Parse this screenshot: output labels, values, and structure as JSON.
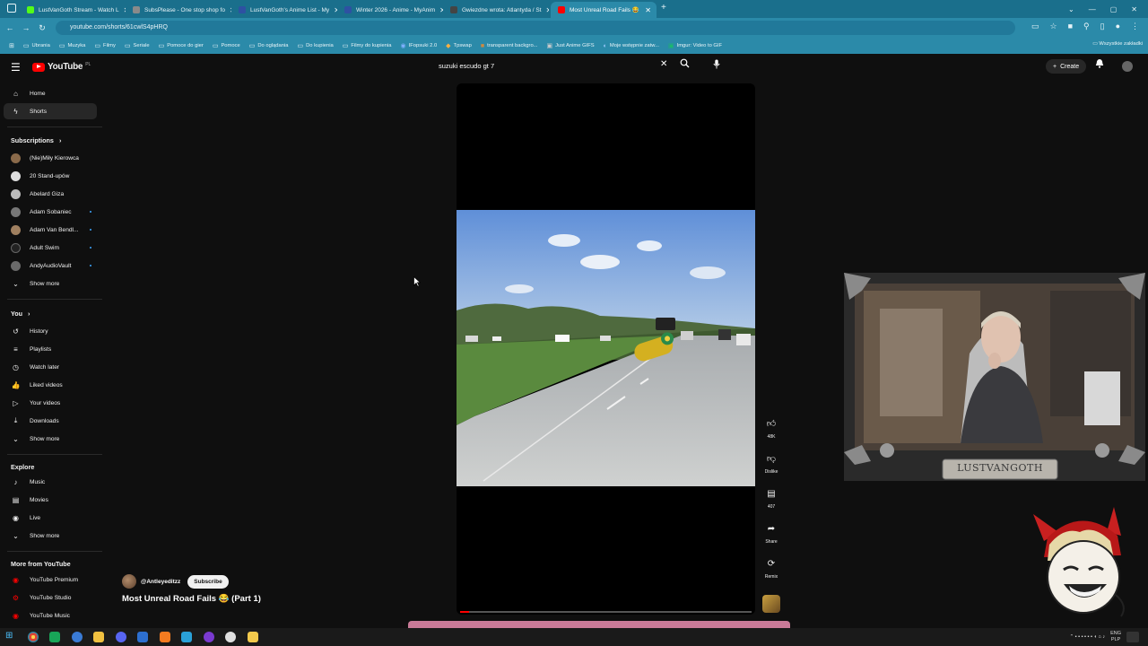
{
  "browser": {
    "tabs": [
      {
        "title": "LustVanGoth Stream - Watch L",
        "favicon_color": "#53fc18",
        "active": false
      },
      {
        "title": "SubsPlease - One stop shop fo",
        "favicon_color": "#8a8a8a",
        "active": false
      },
      {
        "title": "LustVanGoth's Anime List - My",
        "favicon_color": "#2e51a2",
        "active": false
      },
      {
        "title": "Winter 2026 - Anime - MyAnim",
        "favicon_color": "#2e51a2",
        "active": false
      },
      {
        "title": "Gwiezdne wrota: Atlantyda / St",
        "favicon_color": "#444444",
        "active": false
      },
      {
        "title": "Most Unreal Road Fails 😂",
        "favicon_color": "#ff0000",
        "active": true
      }
    ],
    "url": "youtube.com/shorts/61cwlS4pHRQ",
    "bookmarks": [
      {
        "label": "Ubrania",
        "icon": "folder-icon"
      },
      {
        "label": "Muzyka",
        "icon": "folder-icon"
      },
      {
        "label": "Filmy",
        "icon": "folder-icon"
      },
      {
        "label": "Seriale",
        "icon": "folder-icon"
      },
      {
        "label": "Pomoce do gier",
        "icon": "folder-icon"
      },
      {
        "label": "Pomoce",
        "icon": "folder-icon"
      },
      {
        "label": "Do oglądania",
        "icon": "folder-icon"
      },
      {
        "label": "Do kupienia",
        "icon": "folder-icon"
      },
      {
        "label": "Filmy do kupienia",
        "icon": "folder-icon"
      },
      {
        "label": "IFopsuki 2.0",
        "icon": "site-icon"
      },
      {
        "label": "Tpswap",
        "icon": "site-icon"
      },
      {
        "label": "transparent backgro...",
        "icon": "site-icon"
      },
      {
        "label": "Just Anime GIFS",
        "icon": "site-icon"
      },
      {
        "label": "Moje wstępnie zatw...",
        "icon": "site-icon"
      },
      {
        "label": "Imgur: Video to GIF",
        "icon": "site-icon"
      }
    ],
    "bookmarks_all": "Wszystkie zakładki"
  },
  "header": {
    "logo_text": "YouTube",
    "country": "PL",
    "search_value": "suzuki escudo gt 7",
    "create_label": "Create"
  },
  "sidebar": {
    "main": [
      {
        "label": "Home",
        "icon": "home-icon"
      },
      {
        "label": "Shorts",
        "icon": "shorts-icon"
      }
    ],
    "subscriptions_title": "Subscriptions",
    "subscriptions": [
      {
        "label": "(Nie)Miły Kierowca",
        "color": "#8a6a4a",
        "new": false
      },
      {
        "label": "20 Stand-upów",
        "color": "#dddddd",
        "new": false
      },
      {
        "label": "Abelard Giza",
        "color": "#bbbbbb",
        "new": false
      },
      {
        "label": "Adam Sobaniec",
        "color": "#777777",
        "new": true
      },
      {
        "label": "Adam Van Bendl...",
        "color": "#a08060",
        "new": true
      },
      {
        "label": "Adult Swim",
        "color": "#222222",
        "new": true
      },
      {
        "label": "AndyAudioVault",
        "color": "#6a6a6a",
        "new": true
      }
    ],
    "show_more": "Show more",
    "you_title": "You",
    "you": [
      {
        "label": "History",
        "icon": "history-icon"
      },
      {
        "label": "Playlists",
        "icon": "playlists-icon"
      },
      {
        "label": "Watch later",
        "icon": "watch-later-icon"
      },
      {
        "label": "Liked videos",
        "icon": "liked-icon"
      },
      {
        "label": "Your videos",
        "icon": "your-videos-icon"
      },
      {
        "label": "Downloads",
        "icon": "download-icon"
      }
    ],
    "explore_title": "Explore",
    "explore": [
      {
        "label": "Music",
        "icon": "music-icon"
      },
      {
        "label": "Movies",
        "icon": "movies-icon"
      },
      {
        "label": "Live",
        "icon": "live-icon"
      }
    ],
    "more_title": "More from YouTube",
    "more": [
      {
        "label": "YouTube Premium"
      },
      {
        "label": "YouTube Studio"
      },
      {
        "label": "YouTube Music"
      }
    ]
  },
  "short": {
    "channel": "@Antleyeditzz",
    "subscribe_label": "Subscribe",
    "title": "Most Unreal Road Fails 😂 (Part 1)",
    "progress": 0.03,
    "actions": [
      {
        "name": "like",
        "icon": "thumbs-up-icon",
        "label": "48K"
      },
      {
        "name": "dislike",
        "icon": "thumbs-down-icon",
        "label": "Dislike"
      },
      {
        "name": "comments",
        "icon": "comment-icon",
        "label": "407"
      },
      {
        "name": "share",
        "icon": "share-icon",
        "label": "Share"
      },
      {
        "name": "remix",
        "icon": "remix-icon",
        "label": "Remix"
      }
    ]
  },
  "overlay": {
    "webcam_nameplate": "LUSTVANGOTH"
  },
  "taskbar": {
    "lang": "ENG",
    "lang2": "PLP"
  },
  "colors": {
    "chrome_tabbar": "#1a6f8c",
    "chrome_toolbar": "#2b8aa9",
    "yt_bg": "#0f0f0f",
    "yt_red": "#ff0000"
  }
}
